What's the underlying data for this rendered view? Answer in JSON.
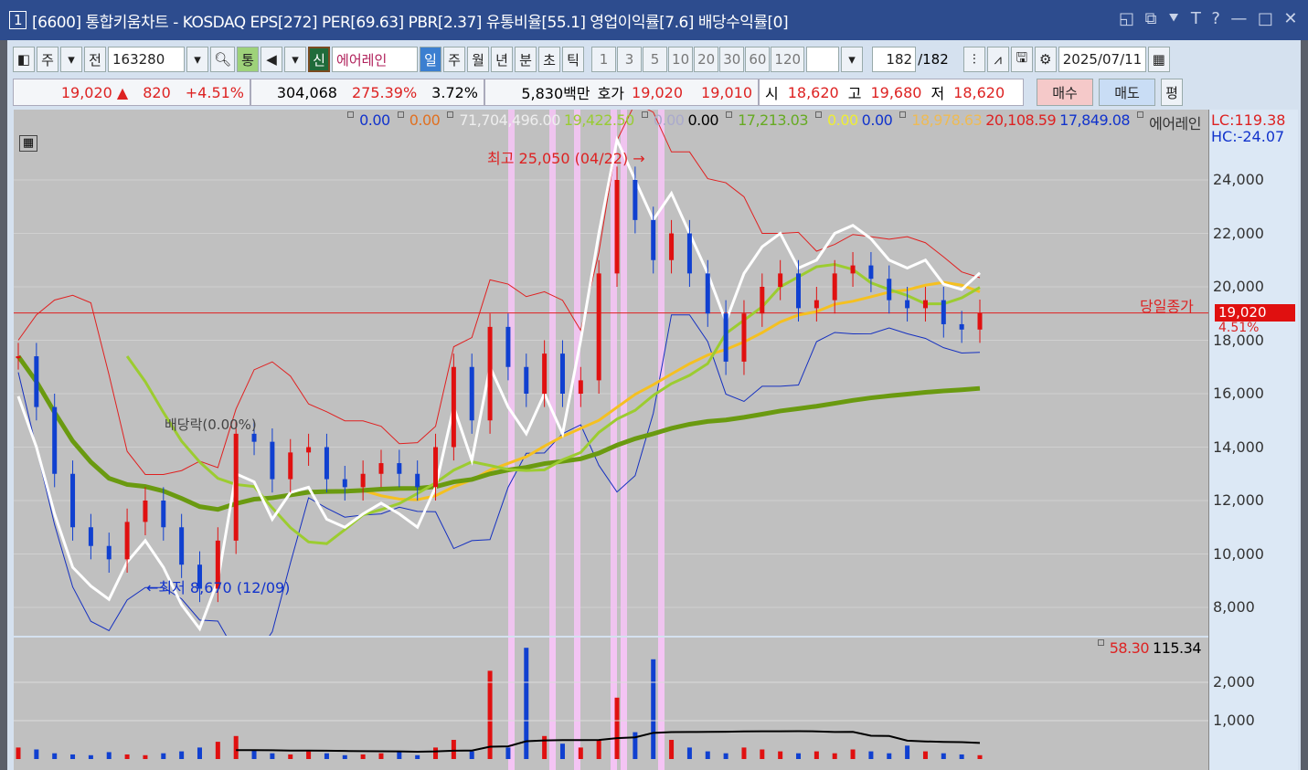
{
  "title": {
    "num": "1",
    "text": "[6600] 통합키움차트 - KOSDAQ EPS[272] PER[69.63] PBR[2.37] 유통비율[55.1] 영업이익률[7.6] 배당수익률[0]",
    "buttons": [
      "◱",
      "⧉",
      "⯆",
      "T",
      "?",
      "—",
      "□",
      "✕"
    ]
  },
  "toolbar": {
    "market": "주",
    "prev": "전",
    "code": "163280",
    "tong": "통",
    "shin": "신",
    "name": "에어레인",
    "periods": [
      "일",
      "주",
      "월",
      "년",
      "분",
      "초",
      "틱"
    ],
    "nums": [
      "1",
      "3",
      "5",
      "10",
      "20",
      "30",
      "60",
      "120"
    ],
    "count": "182",
    "total": "/182",
    "date": "2025/07/11"
  },
  "info": {
    "price": "19,020 ▲",
    "change": "820",
    "pct": "+4.51%",
    "volume": "304,068",
    "vol_ratio": "275.39%",
    "turnover": "3.72%",
    "amount": "5,830백만",
    "hoga_label": "호가",
    "ask": "19,020",
    "bid": "19,010",
    "open_label": "시",
    "open": "18,620",
    "high_label": "고",
    "high": "19,680",
    "low_label": "저",
    "low": "18,620",
    "buy": "매수",
    "sell": "매도",
    "avg": "평"
  },
  "legend": [
    "0.00",
    "0.00",
    "71,704,496.00",
    "19,422.50",
    "0.00",
    "0.00",
    "17,213.03",
    "0.00",
    "0.00",
    "18,978.63",
    "20,108.59",
    "17,849.08",
    "에어레인"
  ],
  "lc": "LC:119.38",
  "hc": "HC:-24.07",
  "annotations": {
    "high": "최고 25,050 (04/22) →",
    "low": "←최저 8,670 (12/09)",
    "div": "배당락(0.00%)",
    "close_label": "당일종가",
    "close_value": "19,020",
    "close_pct": "4.51%"
  },
  "vol_legend": [
    "58.30",
    "115.34"
  ],
  "y_ticks": [
    "24,000",
    "22,000",
    "20,000",
    "18,000",
    "16,000",
    "14,000",
    "12,000",
    "10,000",
    "8,000"
  ],
  "vol_ticks": [
    "2,000",
    "1,000"
  ],
  "chart_data": {
    "type": "candlestick",
    "closes": [
      17400,
      15500,
      13000,
      11000,
      10300,
      9800,
      11200,
      12000,
      11000,
      9600,
      8700,
      10500,
      14500,
      14200,
      12800,
      13800,
      14000,
      12800,
      12500,
      13000,
      13400,
      13000,
      12500,
      14000,
      17000,
      15000,
      18500,
      17000,
      16000,
      17500,
      16000,
      16500,
      20500,
      24000,
      22500,
      21000,
      22000,
      20500,
      19000,
      17200,
      19000,
      20000,
      20500,
      19200,
      19500,
      20500,
      20800,
      20300,
      19500,
      19200,
      19500,
      18600,
      18400,
      19020
    ],
    "volumes": [
      300,
      250,
      150,
      120,
      100,
      180,
      120,
      100,
      150,
      200,
      300,
      450,
      600,
      250,
      150,
      120,
      200,
      150,
      100,
      120,
      150,
      200,
      100,
      300,
      500,
      200,
      2300,
      300,
      2900,
      600,
      400,
      300,
      500,
      1600,
      700,
      2600,
      500,
      300,
      200,
      150,
      300,
      250,
      200,
      150,
      200,
      150,
      250,
      200,
      150,
      350,
      200,
      150,
      120,
      100
    ],
    "ylim": [
      7000,
      25500
    ],
    "vol_max": 3300
  }
}
